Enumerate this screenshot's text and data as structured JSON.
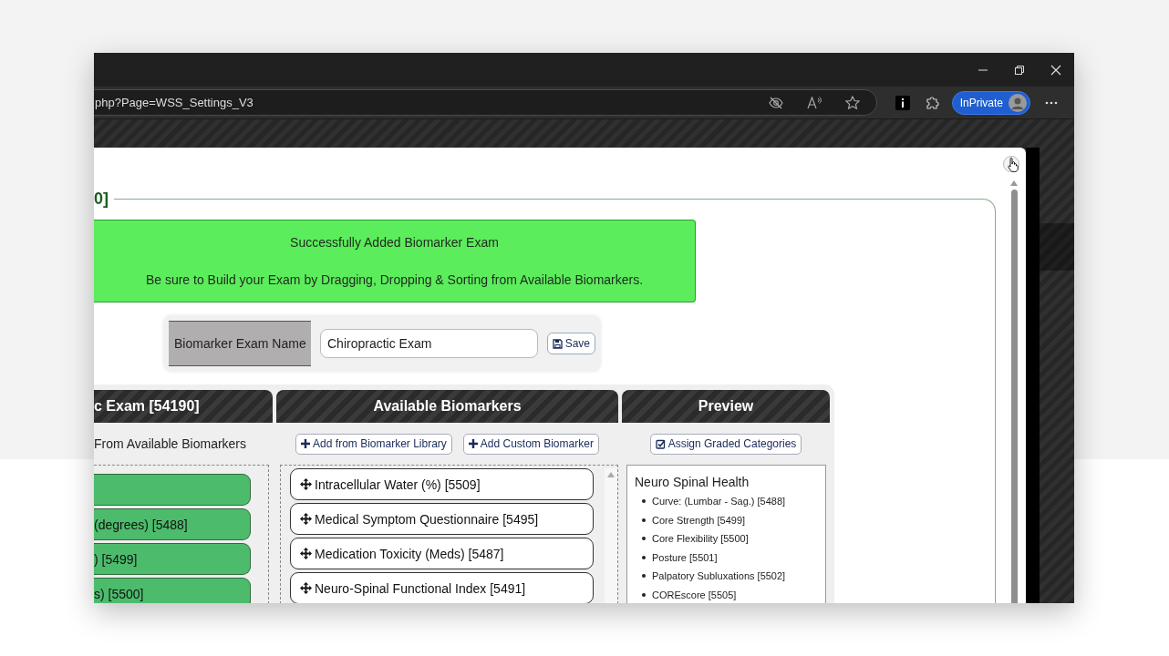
{
  "browser": {
    "address": "php?Page=WSS_Settings_V3",
    "profile_button": "InPrivate"
  },
  "dialog": {
    "legend": "0]",
    "alert": {
      "lines": [
        "Successfully Added Biomarker Exam",
        "Be sure to Build your Exam by Dragging, Dropping & Sorting from Available Biomarkers."
      ]
    },
    "name_field": {
      "label": "Biomarker Exam Name",
      "value": "Chiropractic Exam",
      "save_button": "Save"
    },
    "exam_column": {
      "title": "c Exam [54190]",
      "hint": "From Available Biomarkers",
      "items": [
        {
          "kind": "unlabelled"
        },
        {
          "kind": "labelled",
          "label": "(degrees) [5488]"
        },
        {
          "kind": "labelled",
          "label": ") [5499]"
        },
        {
          "kind": "labelled",
          "label": "s) [5500]"
        }
      ]
    },
    "available_column": {
      "title": "Available Biomarkers",
      "buttons": [
        "Add from Biomarker Library",
        "Add Custom Biomarker"
      ],
      "items": [
        "Intracellular Water (%) [5509]",
        "Medical Symptom Questionnaire [5495]",
        "Medication Toxicity (Meds) [5487]",
        "Neuro-Spinal Functional Index [5491]"
      ]
    },
    "preview_column": {
      "title": "Preview",
      "button": "Assign Graded Categories",
      "category": "Neuro Spinal Health",
      "items": [
        "Curve: (Lumbar - Sag.) [5488]",
        "Core Strength [5499]",
        "Core Flexibility [5500]",
        "Posture [5501]",
        "Palpatory Subluxations [5502]",
        "COREscore [5505]"
      ]
    }
  }
}
